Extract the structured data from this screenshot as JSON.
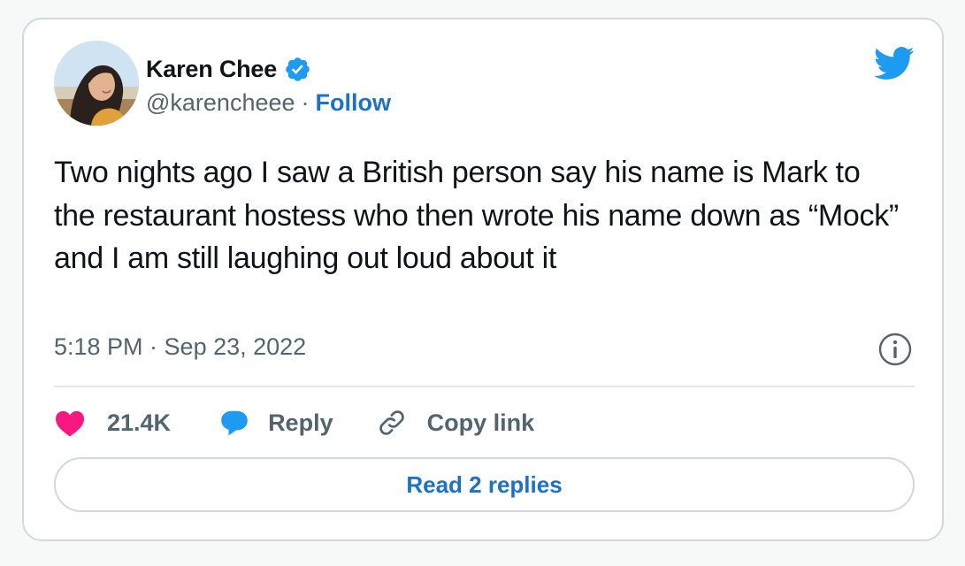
{
  "tweet": {
    "author": {
      "display_name": "Karen Chee",
      "handle": "@karencheee",
      "separator": "·",
      "follow_label": "Follow",
      "verified": true,
      "avatar_icon": "profile-photo"
    },
    "text": "Two nights ago I saw a British person say his name is Mark to the restaurant hostess who then wrote his name down as “Mock” and I am still laughing out loud about it",
    "timestamp": "5:18 PM · Sep 23, 2022",
    "like_count": "21.4K",
    "reply_label": "Reply",
    "copy_link_label": "Copy link",
    "read_replies_label": "Read 2 replies"
  },
  "icons": {
    "brand": "twitter-bird-icon",
    "verified": "verified-badge-icon",
    "info": "info-icon",
    "like": "heart-icon",
    "reply": "speech-bubble-icon",
    "copy": "link-icon"
  },
  "colors": {
    "brand_blue": "#1d9bf0",
    "link_blue": "#1d72c4",
    "like_pink": "#f91880",
    "text_primary": "#0f1419",
    "text_secondary": "#536471",
    "border": "#cfd9de"
  }
}
